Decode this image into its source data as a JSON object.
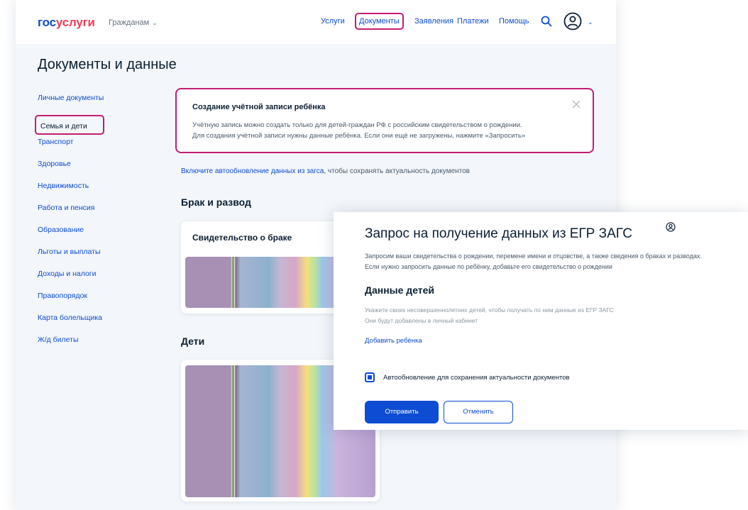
{
  "header": {
    "logo_part1": "гос",
    "logo_part2": "услуги",
    "audience": "Гражданам",
    "nav": [
      "Услуги",
      "Документы",
      "Заявления",
      "Платежи",
      "Помощь"
    ],
    "icons": [
      "search-icon",
      "user-icon",
      "chevron-down-icon"
    ]
  },
  "page": {
    "title": "Документы и данные"
  },
  "sidebar": {
    "items": [
      {
        "label": "Личные документы"
      },
      {
        "label": "Семья и дети",
        "active": true
      },
      {
        "label": "Транспорт"
      },
      {
        "label": "Здоровье"
      },
      {
        "label": "Недвижимость"
      },
      {
        "label": "Работа и пенсия"
      },
      {
        "label": "Образование"
      },
      {
        "label": "Льготы и выплаты"
      },
      {
        "label": "Доходы и налоги"
      },
      {
        "label": "Правопорядок"
      },
      {
        "label": "Карта болельщика"
      },
      {
        "label": "Ж/д билеты"
      }
    ]
  },
  "banner": {
    "title": "Создание учётной записи ребёнка",
    "line1": "Учётную запись можно создать только для детей-граждан РФ с российским свидетельством о рождении.",
    "line2": "Для создания учётной записи нужны данные ребёнка. Если они ещё не загружены, нажмите «Запросить»"
  },
  "auto_update": {
    "link": "Включите автообновление данных из загса",
    "rest": ", чтобы сохранять актуальность документов"
  },
  "sections": {
    "marriage": "Брак и развод",
    "marriage_card": "Свидетельство о браке",
    "children": "Дети"
  },
  "modal": {
    "title": "Запрос на получение данных из ЕГР ЗАГС",
    "text1": "Запросим ваши свидетельства о рождении, перемене имени и отцовстве, а также сведения о браках и разводах.",
    "text2": "Если нужно запросить данные по ребёнку, добавьте его свидетельство о рождении",
    "subtitle": "Данные детей",
    "hint1": "Укажите своих несовершеннолетних детей, чтобы получать по ним данные из ЕГР ЗАГС",
    "hint2": "Они будут добавлены в личный кабинет",
    "add_child": "Добавить ребёнка",
    "checkbox_label": "Автообновление для сохранения актуальности документов",
    "checkbox_checked": true,
    "send": "Отправить",
    "cancel": "Отменить"
  },
  "colors": {
    "brand_blue": "#0d4cd3",
    "brand_red": "#ee3f58",
    "highlight": "#c21d74"
  }
}
